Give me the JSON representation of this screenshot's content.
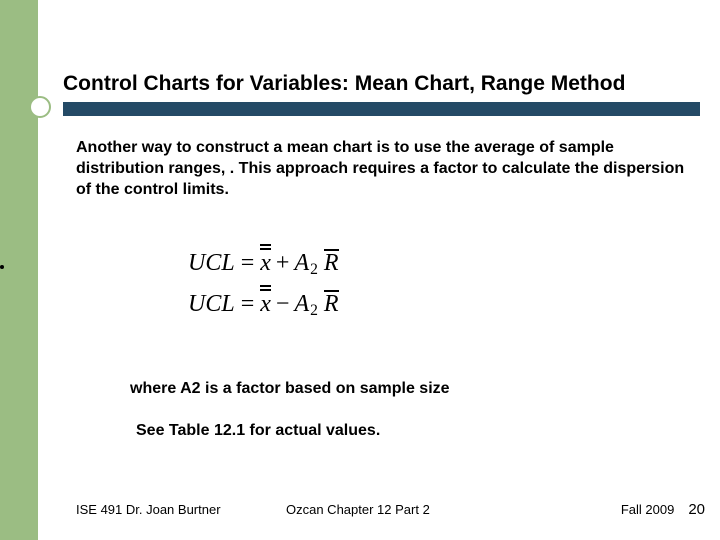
{
  "slide": {
    "title": "Control Charts for Variables: Mean Chart, Range Method",
    "intro": "Another way to construct a mean chart is to use the average of sample distribution ranges, .   This approach requires a factor to calculate the dispersion of the control limits.",
    "formula": {
      "ucl_label": "UCL",
      "lcl_label": "UCL",
      "x": "x",
      "a": "A",
      "a_sub": "2",
      "r": "R",
      "eq": "=",
      "plus": "+",
      "minus": "−"
    },
    "where": "where A2 is a factor based on sample size",
    "see_table": "See Table 12.1 for actual values."
  },
  "footer": {
    "course": "ISE 491  Dr. Joan Burtner",
    "chapter": "Ozcan Chapter 12 Part 2",
    "term": "Fall 2009",
    "page": "20"
  },
  "colors": {
    "sidebar": "#9bbd83",
    "rule": "#244a66"
  }
}
